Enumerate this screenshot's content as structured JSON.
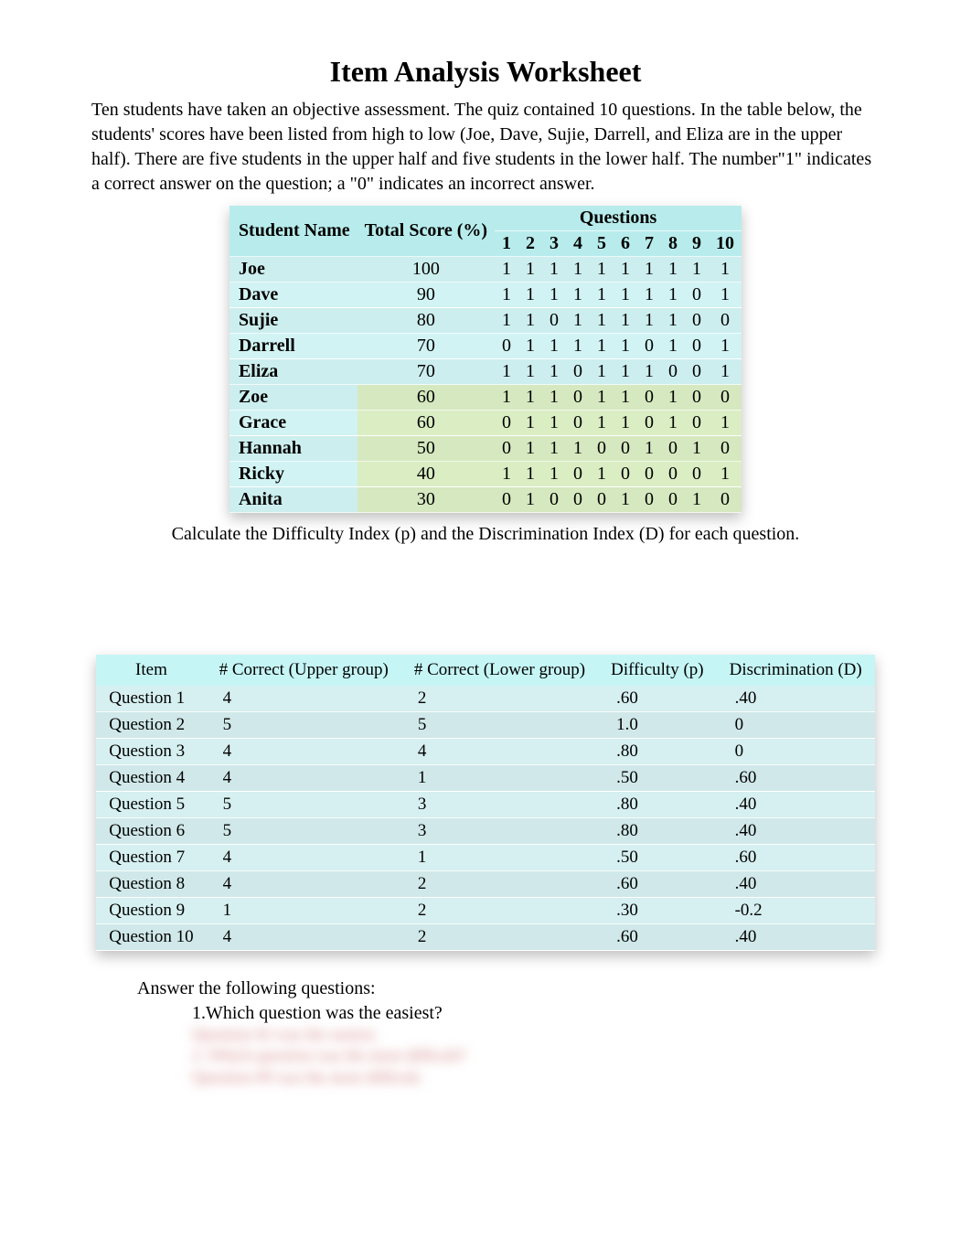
{
  "title": "Item Analysis Worksheet",
  "intro": "Ten students have taken an objective assessment.  The quiz contained 10 questions. In the table below, the students' scores have been listed from high to low (Joe, Dave, Sujie, Darrell, and Eliza are in the upper half). There are five students in the upper half and five students in the lower half. The number\"1\" indicates a correct answer on the question; a \"0\" indicates an incorrect answer.",
  "table1": {
    "headers": {
      "name": "Student Name",
      "score": "Total Score (%)",
      "questions_span": "Questions",
      "q": [
        "1",
        "2",
        "3",
        "4",
        "5",
        "6",
        "7",
        "8",
        "9",
        "10"
      ]
    },
    "upper": [
      {
        "name": "Joe",
        "score": "100",
        "a": [
          "1",
          "1",
          "1",
          "1",
          "1",
          "1",
          "1",
          "1",
          "1",
          "1"
        ]
      },
      {
        "name": "Dave",
        "score": "90",
        "a": [
          "1",
          "1",
          "1",
          "1",
          "1",
          "1",
          "1",
          "1",
          "0",
          "1"
        ]
      },
      {
        "name": "Sujie",
        "score": "80",
        "a": [
          "1",
          "1",
          "0",
          "1",
          "1",
          "1",
          "1",
          "1",
          "0",
          "0"
        ]
      },
      {
        "name": "Darrell",
        "score": "70",
        "a": [
          "0",
          "1",
          "1",
          "1",
          "1",
          "1",
          "0",
          "1",
          "0",
          "1"
        ]
      },
      {
        "name": "Eliza",
        "score": "70",
        "a": [
          "1",
          "1",
          "1",
          "0",
          "1",
          "1",
          "1",
          "0",
          "0",
          "1"
        ]
      }
    ],
    "lower": [
      {
        "name": "Zoe",
        "score": "60",
        "a": [
          "1",
          "1",
          "1",
          "0",
          "1",
          "1",
          "0",
          "1",
          "0",
          "0"
        ]
      },
      {
        "name": "Grace",
        "score": "60",
        "a": [
          "0",
          "1",
          "1",
          "0",
          "1",
          "1",
          "0",
          "1",
          "0",
          "1"
        ]
      },
      {
        "name": "Hannah",
        "score": "50",
        "a": [
          "0",
          "1",
          "1",
          "1",
          "0",
          "0",
          "1",
          "0",
          "1",
          "0"
        ]
      },
      {
        "name": "Ricky",
        "score": "40",
        "a": [
          "1",
          "1",
          "1",
          "0",
          "1",
          "0",
          "0",
          "0",
          "0",
          "1"
        ]
      },
      {
        "name": "Anita",
        "score": "30",
        "a": [
          "0",
          "1",
          "0",
          "0",
          "0",
          "1",
          "0",
          "0",
          "1",
          "0"
        ]
      }
    ]
  },
  "instruction": "Calculate the Difficulty Index (p) and the Discrimination Index (D) for each question.",
  "table2": {
    "headers": {
      "item": "Item",
      "upper": "# Correct (Upper group)",
      "lower": "# Correct (Lower group)",
      "p": "Difficulty (p)",
      "d": "Discrimination (D)"
    },
    "rows": [
      {
        "item": "Question 1",
        "u": "4",
        "l": "2",
        "p": ".60",
        "d": ".40"
      },
      {
        "item": "Question 2",
        "u": "5",
        "l": "5",
        "p": "1.0",
        "d": "0"
      },
      {
        "item": "Question 3",
        "u": "4",
        "l": "4",
        "p": ".80",
        "d": "0"
      },
      {
        "item": "Question 4",
        "u": "4",
        "l": "1",
        "p": ".50",
        "d": ".60"
      },
      {
        "item": "Question 5",
        "u": "5",
        "l": "3",
        "p": ".80",
        "d": ".40"
      },
      {
        "item": "Question 6",
        "u": "5",
        "l": "3",
        "p": ".80",
        "d": ".40"
      },
      {
        "item": "Question 7",
        "u": "4",
        "l": "1",
        "p": ".50",
        "d": ".60"
      },
      {
        "item": "Question 8",
        "u": "4",
        "l": "2",
        "p": ".60",
        "d": ".40"
      },
      {
        "item": "Question 9",
        "u": "1",
        "l": "2",
        "p": ".30",
        "d": "-0.2"
      },
      {
        "item": "Question 10",
        "u": "4",
        "l": "2",
        "p": ".60",
        "d": " .40"
      }
    ]
  },
  "followup": "Answer the following questions:",
  "question1": "1.Which question was the easiest?",
  "blurred1": "Question #2 was the easiest.",
  "blurred2": "2. Which question was the most difficult?",
  "blurred3": "Question #9 was the most difficult.",
  "chart_data": {
    "type": "table",
    "title": "Item Analysis Worksheet",
    "scores_table": {
      "columns": [
        "Student Name",
        "Total Score (%)",
        "Q1",
        "Q2",
        "Q3",
        "Q4",
        "Q5",
        "Q6",
        "Q7",
        "Q8",
        "Q9",
        "Q10"
      ],
      "rows": [
        [
          "Joe",
          100,
          1,
          1,
          1,
          1,
          1,
          1,
          1,
          1,
          1,
          1
        ],
        [
          "Dave",
          90,
          1,
          1,
          1,
          1,
          1,
          1,
          1,
          1,
          0,
          1
        ],
        [
          "Sujie",
          80,
          1,
          1,
          0,
          1,
          1,
          1,
          1,
          1,
          0,
          0
        ],
        [
          "Darrell",
          70,
          0,
          1,
          1,
          1,
          1,
          1,
          0,
          1,
          0,
          1
        ],
        [
          "Eliza",
          70,
          1,
          1,
          1,
          0,
          1,
          1,
          1,
          0,
          0,
          1
        ],
        [
          "Zoe",
          60,
          1,
          1,
          1,
          0,
          1,
          1,
          0,
          1,
          0,
          0
        ],
        [
          "Grace",
          60,
          0,
          1,
          1,
          0,
          1,
          1,
          0,
          1,
          0,
          1
        ],
        [
          "Hannah",
          50,
          0,
          1,
          1,
          1,
          0,
          0,
          1,
          0,
          1,
          0
        ],
        [
          "Ricky",
          40,
          1,
          1,
          1,
          0,
          1,
          0,
          0,
          0,
          0,
          1
        ],
        [
          "Anita",
          30,
          0,
          1,
          0,
          0,
          0,
          1,
          0,
          0,
          1,
          0
        ]
      ]
    },
    "analysis_table": {
      "columns": [
        "Item",
        "# Correct (Upper group)",
        "# Correct (Lower group)",
        "Difficulty (p)",
        "Discrimination (D)"
      ],
      "rows": [
        [
          "Question 1",
          4,
          2,
          0.6,
          0.4
        ],
        [
          "Question 2",
          5,
          5,
          1.0,
          0
        ],
        [
          "Question 3",
          4,
          4,
          0.8,
          0
        ],
        [
          "Question 4",
          4,
          1,
          0.5,
          0.6
        ],
        [
          "Question 5",
          5,
          3,
          0.8,
          0.4
        ],
        [
          "Question 6",
          5,
          3,
          0.8,
          0.4
        ],
        [
          "Question 7",
          4,
          1,
          0.5,
          0.6
        ],
        [
          "Question 8",
          4,
          2,
          0.6,
          0.4
        ],
        [
          "Question 9",
          1,
          2,
          0.3,
          -0.2
        ],
        [
          "Question 10",
          4,
          2,
          0.6,
          0.4
        ]
      ]
    }
  }
}
